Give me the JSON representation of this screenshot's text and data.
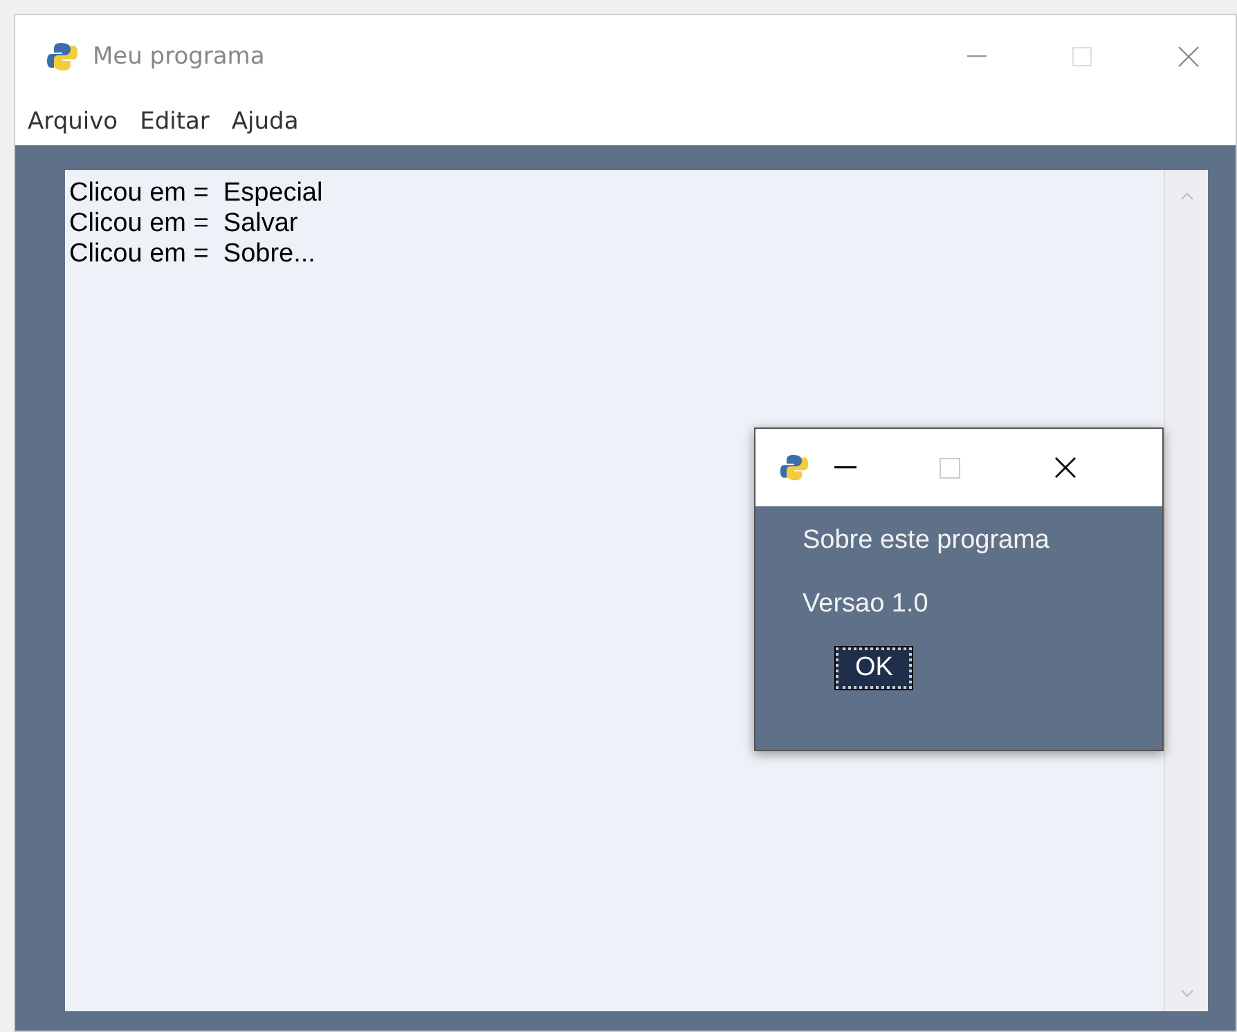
{
  "window": {
    "title": "Meu programa"
  },
  "menu": [
    {
      "label": "Arquivo"
    },
    {
      "label": "Editar"
    },
    {
      "label": "Ajuda"
    }
  ],
  "output_lines": [
    "Clicou em =  Especial",
    "Clicou em =  Salvar",
    "Clicou em =  Sobre..."
  ],
  "dialog": {
    "lines": [
      "Sobre este programa",
      "Versao 1.0"
    ],
    "button": "OK"
  }
}
